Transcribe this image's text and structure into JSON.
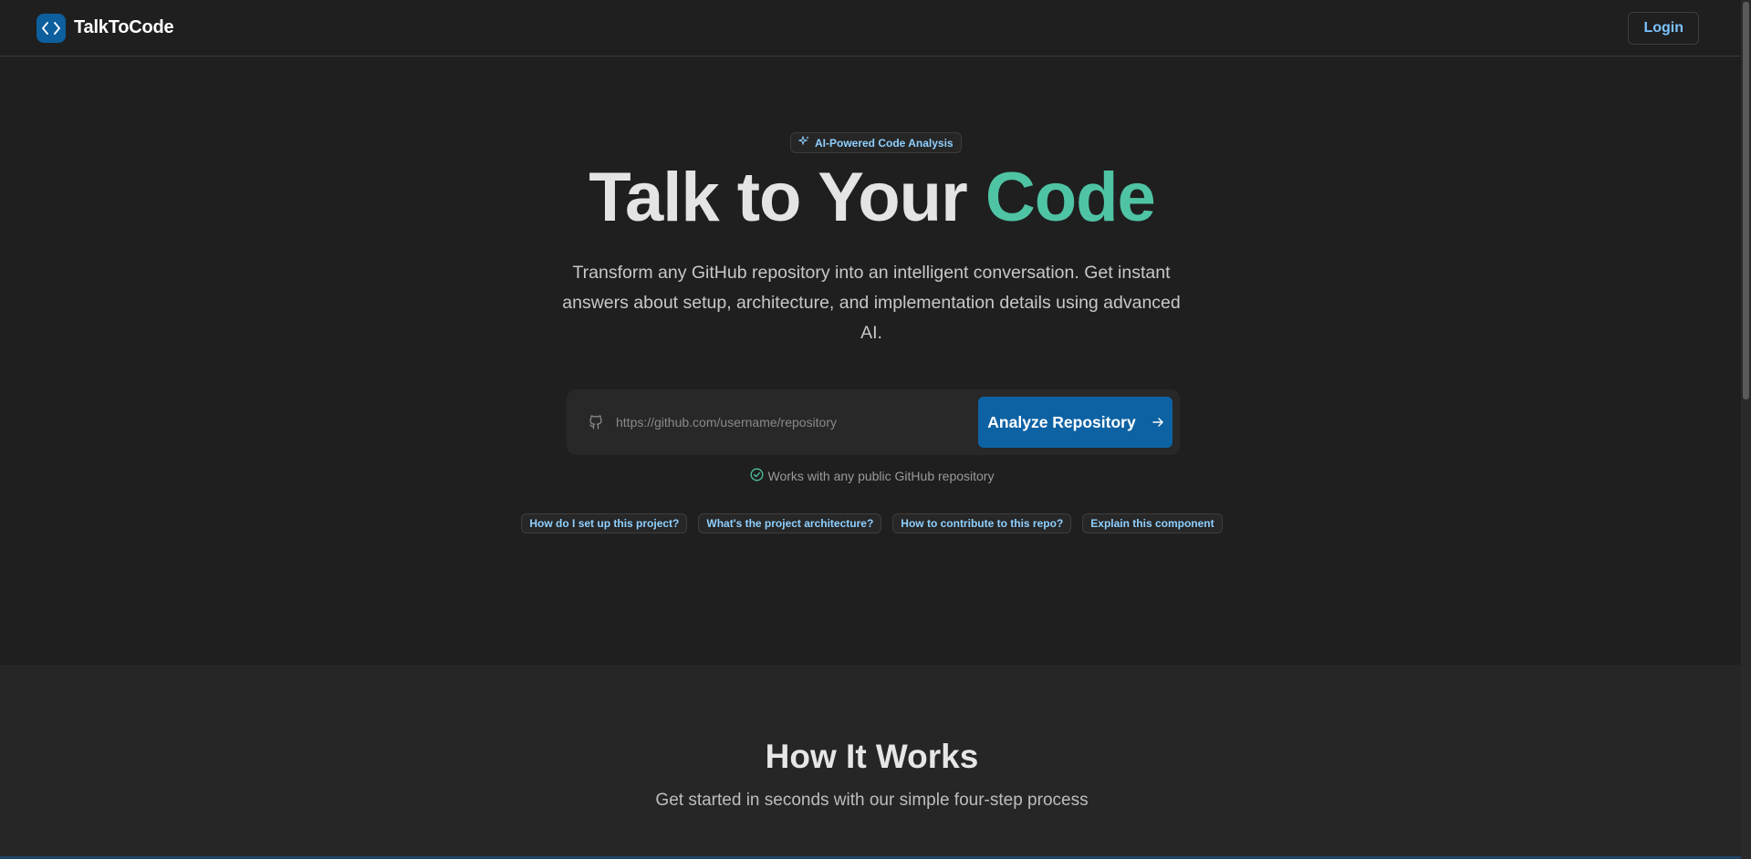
{
  "header": {
    "brand_name": "TalkToCode",
    "login_label": "Login"
  },
  "hero": {
    "badge": "AI-Powered Code Analysis",
    "title_main": "Talk to Your ",
    "title_accent": "Code",
    "subtitle": "Transform any GitHub repository into an intelligent conversation. Get instant answers about setup, architecture, and implementation details using advanced AI.",
    "search": {
      "placeholder": "https://github.com/username/repository",
      "value": "",
      "button_label": "Analyze Repository"
    },
    "works_note": "Works with any public GitHub repository",
    "suggestions": [
      "How do I set up this project?",
      "What's the project architecture?",
      "How to contribute to this repo?",
      "Explain this component"
    ]
  },
  "how_it_works": {
    "title": "How It Works",
    "subtitle": "Get started in seconds with our simple four-step process"
  },
  "icons": {
    "brand": "code-brackets-icon",
    "badge": "sparkles-icon",
    "input": "github-icon",
    "button": "arrow-right-icon",
    "note": "check-circle-icon"
  },
  "colors": {
    "background": "#1f1f1f",
    "accent": "#4fc4a4",
    "primary": "#0d62a3",
    "link": "#8fd0ff"
  }
}
